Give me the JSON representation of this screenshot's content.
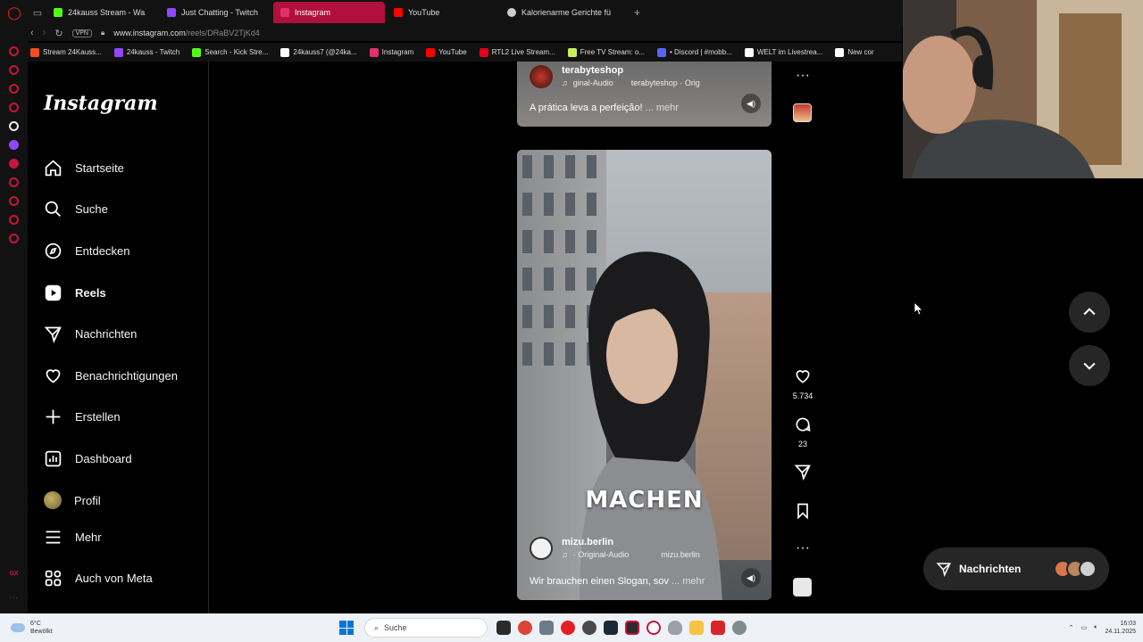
{
  "browser": {
    "tabs": [
      {
        "label": "24kauss Stream - Wa",
        "color": "#53fc18",
        "active": false
      },
      {
        "label": "Just Chatting - Twitch",
        "color": "#9146ff",
        "active": false
      },
      {
        "label": "Instagram",
        "color": "#e1306c",
        "active": true
      },
      {
        "label": "YouTube",
        "color": "#ff0000",
        "active": false
      },
      {
        "label": "Kalorienarme Gerichte fü",
        "color": "#cccccc",
        "active": false
      }
    ],
    "url_host": "www.instagram.com",
    "url_path": "/reels/DRaBV2TjKd4",
    "vpn_label": "VPN",
    "bookmarks": [
      {
        "label": "Stream 24Kauss...",
        "color": "#f25022"
      },
      {
        "label": "24kauss - Twitch",
        "color": "#9146ff"
      },
      {
        "label": "Search - Kick Stre...",
        "color": "#53fc18"
      },
      {
        "label": "24kauss7 (@24ka...",
        "color": "#ffffff"
      },
      {
        "label": "Instagram",
        "color": "#e1306c"
      },
      {
        "label": "YouTube",
        "color": "#ff0000"
      },
      {
        "label": "RTL2 Live Stream...",
        "color": "#e2001a"
      },
      {
        "label": "Free TV Stream: o...",
        "color": "#c8f05a"
      },
      {
        "label": "• Discord | #mobb...",
        "color": "#5865f2"
      },
      {
        "label": "WELT im Livestrea...",
        "color": "#ffffff"
      },
      {
        "label": "New cor",
        "color": "#ffffff"
      }
    ]
  },
  "instagram": {
    "logo": "Instagram",
    "nav": [
      {
        "label": "Startseite",
        "icon": "home-icon"
      },
      {
        "label": "Suche",
        "icon": "search-icon"
      },
      {
        "label": "Entdecken",
        "icon": "compass-icon"
      },
      {
        "label": "Reels",
        "icon": "reels-icon"
      },
      {
        "label": "Nachrichten",
        "icon": "send-icon"
      },
      {
        "label": "Benachrichtigungen",
        "icon": "heart-icon"
      },
      {
        "label": "Erstellen",
        "icon": "plus-icon"
      },
      {
        "label": "Dashboard",
        "icon": "dashboard-icon"
      },
      {
        "label": "Profil",
        "icon": "avatar"
      }
    ],
    "bottom_nav": [
      {
        "label": "Mehr",
        "icon": "menu-icon"
      },
      {
        "label": "Auch von Meta",
        "icon": "meta-icon"
      }
    ]
  },
  "reel_prev": {
    "username": "terabyteshop",
    "audio": "ginal-Audio",
    "audio_owner": "terabyteshop · Orig",
    "caption": "A prática leva a perfeição!",
    "more": "... mehr"
  },
  "reel": {
    "overlay_text": "MACHEN",
    "username": "mizu.berlin",
    "audio": "· Original-Audio",
    "audio_owner": "mizu.berlin",
    "caption": "Wir brauchen einen Slogan, sov",
    "more": "... mehr",
    "likes": "5.734",
    "comments": "23"
  },
  "messages_pill": {
    "label": "Nachrichten"
  },
  "taskbar": {
    "weather_temp": "6°C",
    "weather_text": "Bewölkt",
    "search": "Suche",
    "time": "16:03",
    "date": "24.11.2025"
  }
}
